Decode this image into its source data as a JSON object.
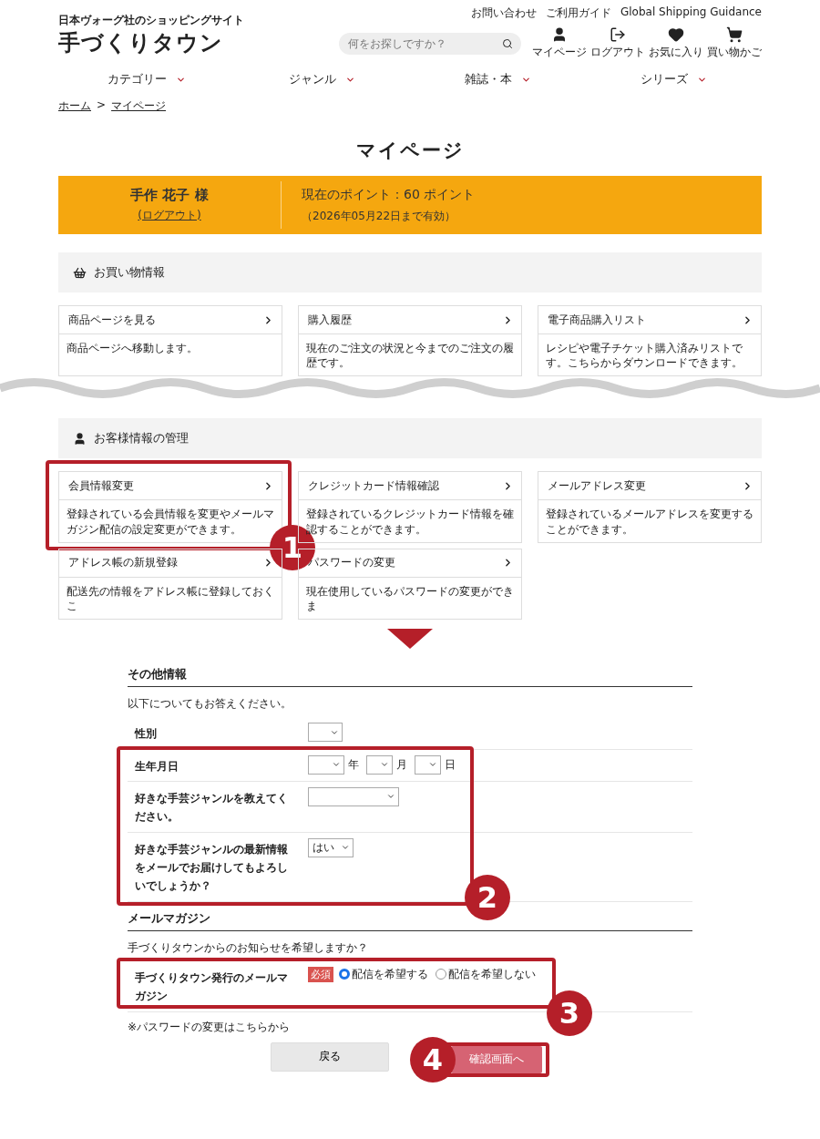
{
  "header": {
    "tagline": "日本ヴォーグ社のショッピングサイト",
    "logo": "手づくりタウン",
    "top_links": [
      "お問い合わせ",
      "ご利用ガイド",
      "Global Shipping Guidance"
    ],
    "search": {
      "placeholder": "何をお探しですか？"
    },
    "icon_links": [
      "マイページ",
      "ログアウト",
      "お気に入り",
      "買い物かご"
    ]
  },
  "nav": [
    "カテゴリー",
    "ジャンル",
    "雑誌・本",
    "シリーズ"
  ],
  "breadcrumb": [
    "ホーム",
    ">",
    "マイページ"
  ],
  "page_title": "マイページ",
  "member": {
    "name": "手作 花子 様",
    "logout": "(ログアウト)",
    "points": "現在のポイント：60 ポイント",
    "expiry": "（2026年05月22日まで有効）"
  },
  "sections": [
    {
      "title": "お買い物情報",
      "cards": [
        {
          "title": "商品ページを見る",
          "description": "商品ページへ移動します。"
        },
        {
          "title": "購入履歴",
          "description": "現在のご注文の状況と今までのご注文の履歴です。"
        },
        {
          "title": "電子商品購入リスト",
          "description": "レシピや電子チケット購入済みリストです。こちらからダウンロードできます。"
        }
      ]
    },
    {
      "title": "お客様情報の管理",
      "cards": [
        {
          "title": "会員情報変更",
          "description": "登録されている会員情報を変更やメールマガジン配信の設定変更ができます。",
          "callout": "1"
        },
        {
          "title": "クレジットカード情報確認",
          "description": "登録されているクレジットカード情報を確認することができます。"
        },
        {
          "title": "メールアドレス変更",
          "description": "登録されているメールアドレスを変更することができます。"
        },
        {
          "title": "アドレス帳の新規登録",
          "description": "配送先の情報をアドレス帳に登録しておくこ"
        },
        {
          "title": "パスワードの変更",
          "description": "現在使用しているパスワードの変更ができま"
        }
      ]
    }
  ],
  "form_sections": [
    {
      "heading": "その他情報",
      "intro": "以下についてもお答えください。",
      "items": [
        {
          "kind": "select",
          "label": "性別"
        },
        {
          "kind": "group",
          "callout": "2",
          "rows": [
            {
              "kind": "date",
              "label": "生年月日",
              "selects": [
                {
                  "suffix": "年"
                },
                {
                  "suffix": "月"
                },
                {
                  "suffix": "日"
                }
              ]
            },
            {
              "kind": "select",
              "label": "好きな手芸ジャンルを教えてください。"
            },
            {
              "kind": "select",
              "label": "好きな手芸ジャンルの最新情報をメールでお届けしてもよろしいでしょうか？",
              "value": "はい"
            }
          ]
        }
      ]
    },
    {
      "heading": "メールマガジン",
      "intro": "手づくりタウンからのお知らせを希望しますか？",
      "items": [
        {
          "kind": "group",
          "callout": "3",
          "rows": [
            {
              "kind": "radio",
              "label": "手づくりタウン発行のメールマガジン",
              "required": "必須",
              "options": [
                {
                  "label": "配信を希望する",
                  "selected": true
                },
                {
                  "label": "配信を希望しない",
                  "selected": false
                }
              ]
            }
          ]
        }
      ]
    }
  ],
  "note": "※パスワードの変更はこちらから",
  "buttons": {
    "back": "戻る",
    "confirm": {
      "label": "確認画面へ",
      "callout": "4"
    }
  }
}
